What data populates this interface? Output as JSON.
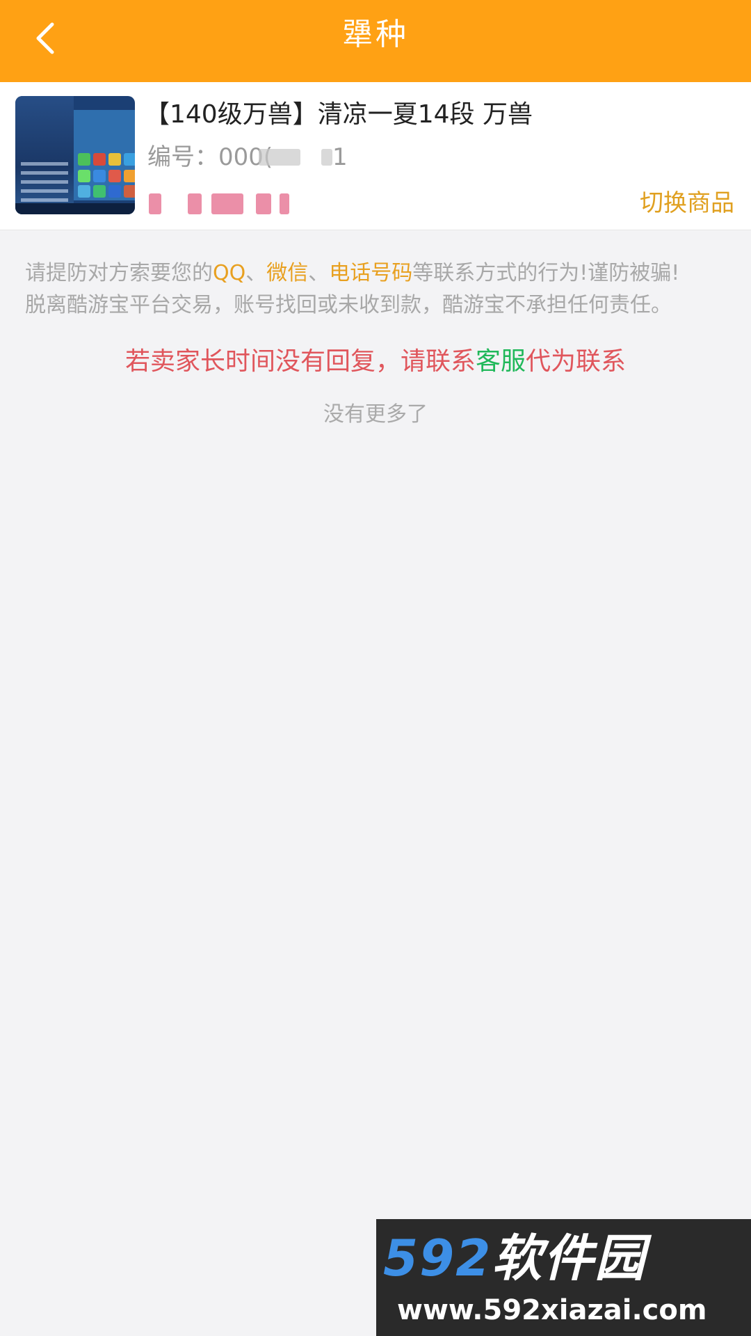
{
  "header": {
    "title": "犟种",
    "back_icon": "chevron-left-icon"
  },
  "product": {
    "title": "【140级万兽】清凉一夏14段 万兽",
    "id_label": "编号：",
    "id_value": "000(",
    "id_tail": "1",
    "switch_label": "切换商品"
  },
  "notice": {
    "part1": "请提防对方索要您的",
    "qq": "QQ",
    "sep1": "、",
    "wechat": "微信",
    "sep2": "、",
    "phone": "电话号码",
    "part2": "等联系方式的行为!谨防被骗!",
    "line2": "脱离酷游宝平台交易，账号找回或未收到款，酷游宝不承担任何责任。"
  },
  "contact": {
    "before": "若卖家长时间没有回复，请联系",
    "link": "客服",
    "after": "代为联系"
  },
  "list_end": "没有更多了",
  "watermark": {
    "logo_num": "592",
    "logo_text": "软件园",
    "url": "www.592xiazai.com"
  },
  "colors": {
    "header_bg": "#ffa114",
    "highlight": "#e8a020",
    "contact_red": "#e0565c",
    "service_green": "#20b85a"
  }
}
